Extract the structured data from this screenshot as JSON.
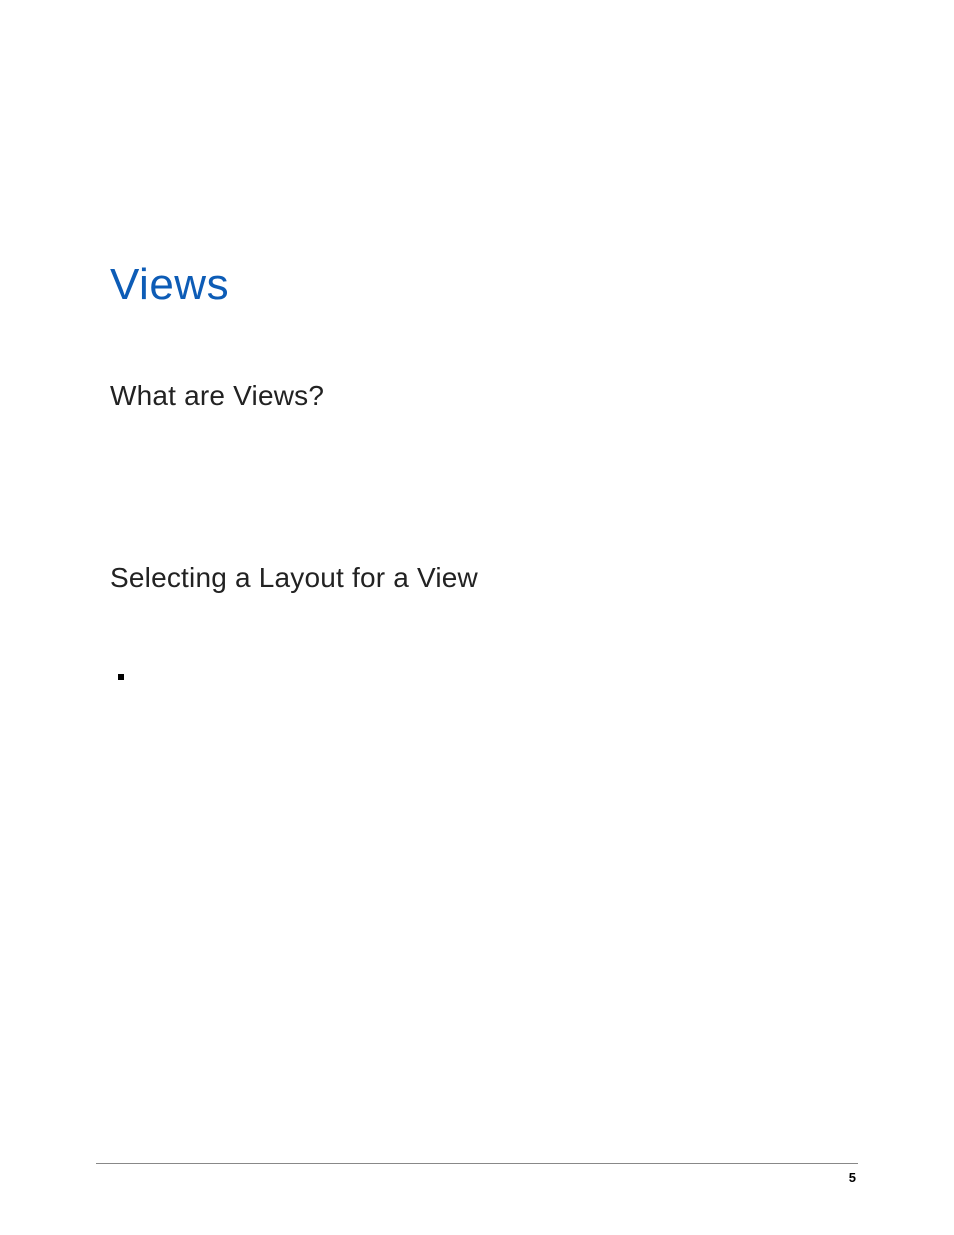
{
  "chapter": {
    "title": "Views"
  },
  "sections": {
    "first": "What are Views?",
    "second": "Selecting a Layout for a View"
  },
  "footer": {
    "page_number": "5"
  }
}
